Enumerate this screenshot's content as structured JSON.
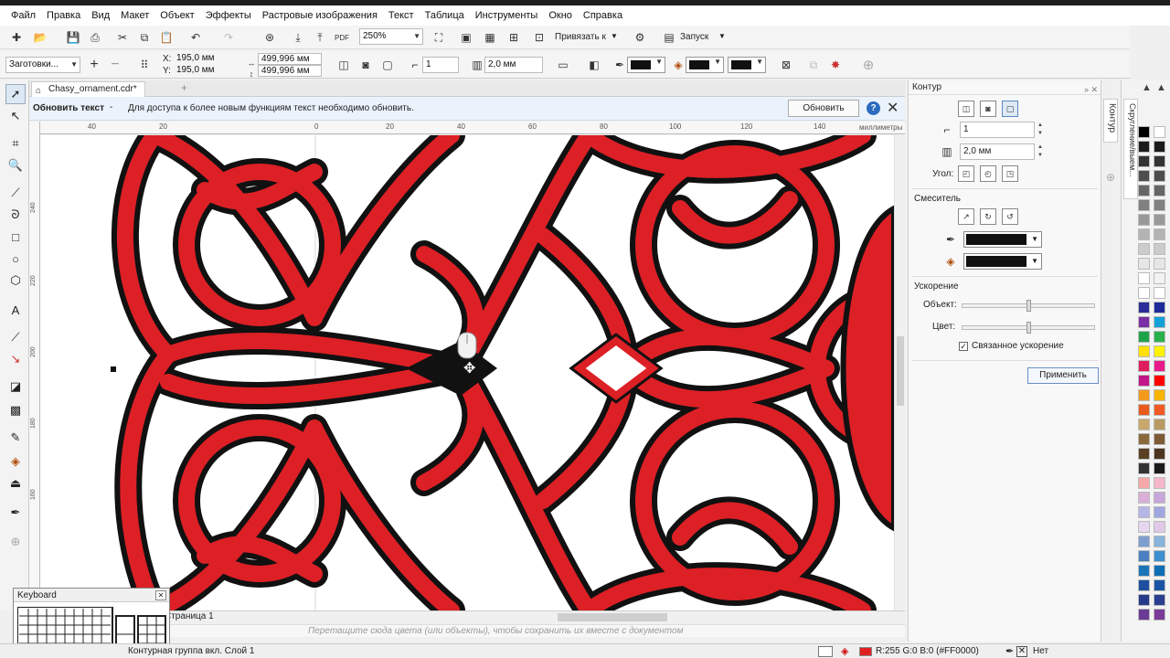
{
  "menu": [
    "Файл",
    "Правка",
    "Вид",
    "Макет",
    "Объект",
    "Эффекты",
    "Растровые изображения",
    "Текст",
    "Таблица",
    "Инструменты",
    "Окно",
    "Справка"
  ],
  "toolbar": {
    "zoom": "250%",
    "snap_label": "Привязать к",
    "launch_label": "Запуск"
  },
  "propbar": {
    "preset": "Заготовки...",
    "x_label": "X:",
    "x": "195,0 мм",
    "y_label": "Y:",
    "y": "195,0 мм",
    "width": "499,996 мм",
    "height": "499,996 мм",
    "steps": "1",
    "offset": "2,0 мм"
  },
  "document": {
    "tab": "Chasy_ornament.cdr*",
    "page_tab": "Страница 1"
  },
  "notification": {
    "title": "Обновить текст",
    "dash": "-",
    "message": "Для доступа к более новым функциям текст необходимо обновить.",
    "button": "Обновить"
  },
  "ruler": {
    "units": "миллиметры",
    "h_ticks": [
      "40",
      "20",
      "0",
      "20",
      "40",
      "60",
      "80",
      "100",
      "120",
      "140"
    ],
    "v_ticks": [
      "240",
      "220",
      "200",
      "180",
      "160"
    ]
  },
  "docker": {
    "title": "Контур",
    "steps": "1",
    "offset": "2,0 мм",
    "angle_label": "Угол:",
    "blend_label": "Смеситель",
    "accel_label": "Ускорение",
    "object_label": "Объект:",
    "color_label": "Цвет:",
    "linked_label": "Связанное ускорение",
    "apply_button": "Применить",
    "object_accel": 0.5,
    "color_accel": 0.5
  },
  "vtabs": [
    "Контур",
    "Скругление/выем..."
  ],
  "hint": "Перетащите сюда цвета (или объекты), чтобы сохранить их вместе с документом",
  "status": {
    "left": "Контурная группа вкл. Слой 1",
    "fill_color": "R:255 G:0 B:0 (#FF0000)",
    "outline": "Нет"
  },
  "keyboard_window": {
    "title": "Keyboard"
  },
  "colors": {
    "accent_red": "#dc2026",
    "outline_black": "#111111"
  }
}
